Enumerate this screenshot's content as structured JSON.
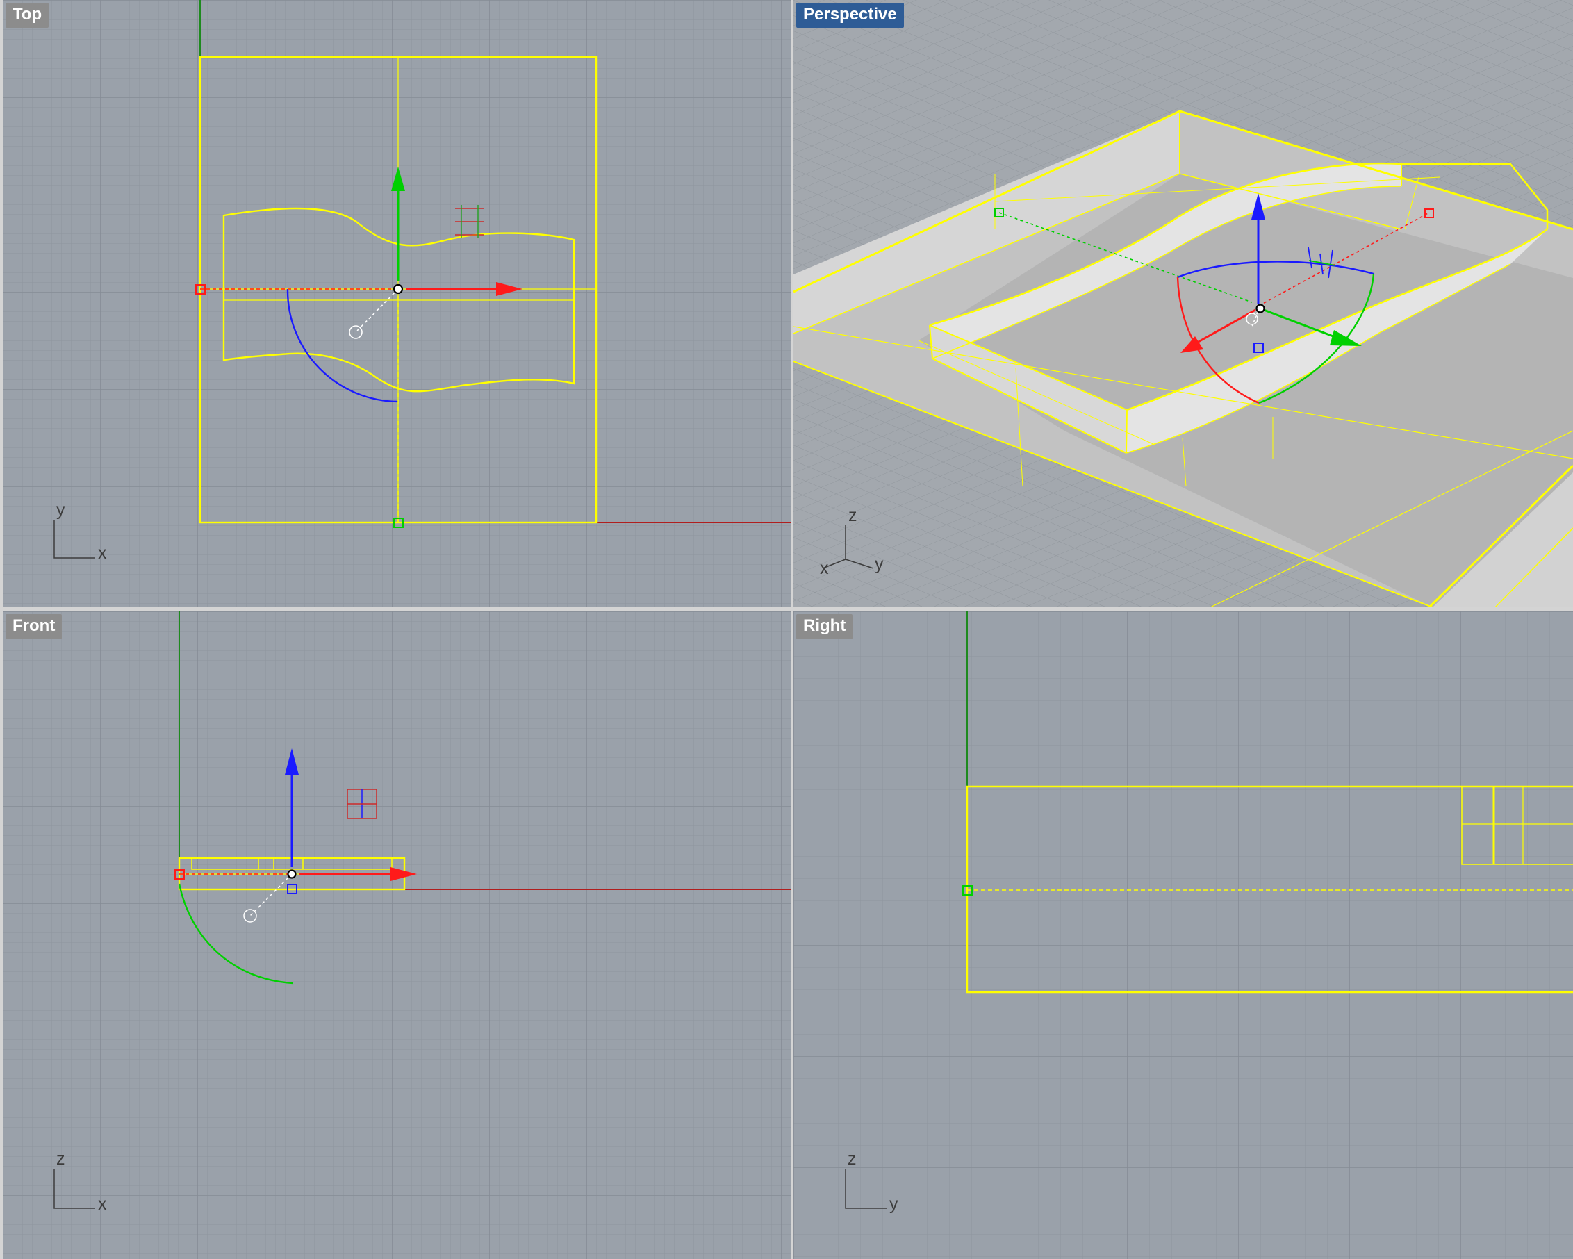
{
  "viewports": {
    "top": {
      "label": "Top",
      "axes": [
        "y",
        "x"
      ]
    },
    "perspective": {
      "label": "Perspective",
      "axes": [
        "z",
        "x",
        "y"
      ]
    },
    "front": {
      "label": "Front",
      "axes": [
        "z",
        "x"
      ]
    },
    "right": {
      "label": "Right",
      "axes": [
        "z",
        "y"
      ]
    }
  },
  "colors": {
    "viewport_bg": "#9aa1aa",
    "perspective_sky": "#a3a8ae",
    "grid_minor": "#8e959e",
    "grid_major": "#858c95",
    "selection": "#ffff00",
    "x_axis": "#ff1a1a",
    "y_axis": "#00d000",
    "z_axis": "#1a1aff",
    "active_label": "#2e5c96",
    "inactive_label": "#8c8c8c"
  },
  "icons": [
    "gumball-x-arrow-icon",
    "gumball-y-arrow-icon",
    "gumball-z-arrow-icon",
    "gumball-rotate-arc-icon",
    "gumball-scale-handle-icon",
    "gumball-center-icon",
    "world-axes-icon"
  ]
}
